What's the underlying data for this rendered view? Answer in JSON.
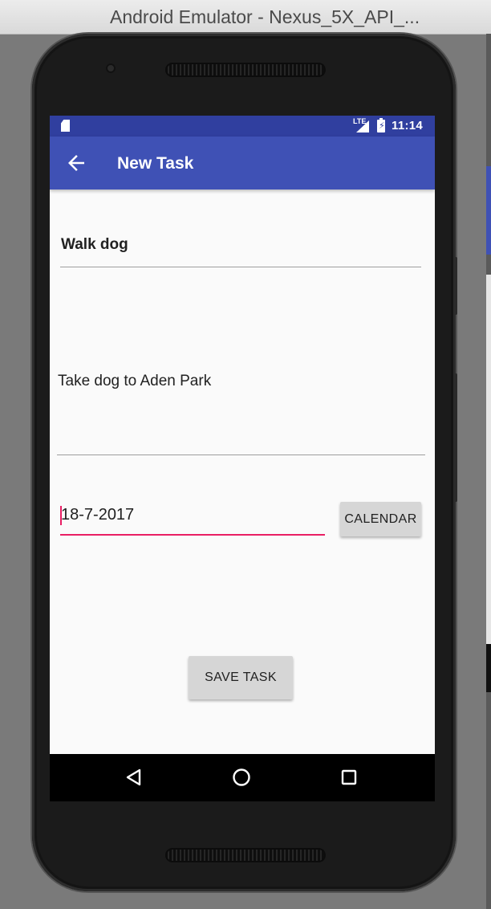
{
  "window": {
    "title": "Android Emulator - Nexus_5X_API_..."
  },
  "status_bar": {
    "network": "LTE",
    "time": "11:14",
    "icons": [
      "sd-card-icon",
      "signal-icon",
      "battery-charging-icon"
    ]
  },
  "app_bar": {
    "title": "New Task",
    "back_icon": "arrow-back-icon"
  },
  "form": {
    "task_title": "Walk dog",
    "task_description": "Take dog to Aden Park",
    "task_date": "18-7-2017",
    "calendar_button": "CALENDAR",
    "save_button": "SAVE TASK"
  },
  "nav_bar": {
    "icons": [
      "nav-back-icon",
      "nav-home-icon",
      "nav-recents-icon"
    ]
  },
  "colors": {
    "primary": "#3f51b5",
    "primary_dark": "#303f9f",
    "accent": "#e91e63",
    "background": "#fafafa"
  }
}
